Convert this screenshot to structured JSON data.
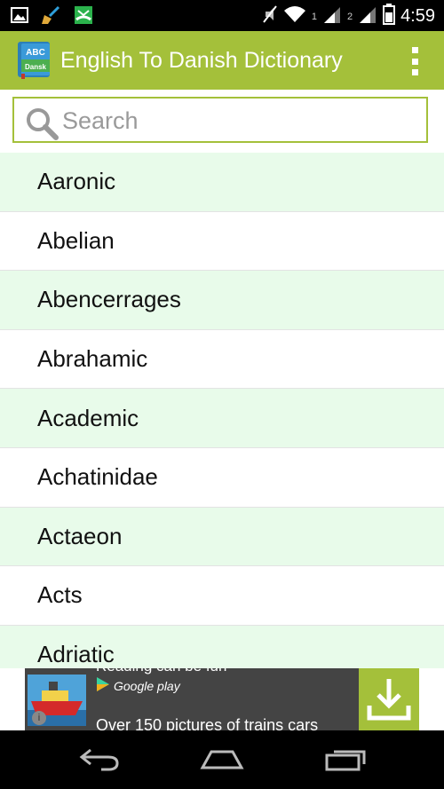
{
  "status_bar": {
    "time": "4:59",
    "sim1_label": "1",
    "sim2_label": "2"
  },
  "action_bar": {
    "icon_top_text": "ABC",
    "icon_bottom_text": "Dansk",
    "title": "English To Danish Dictionary"
  },
  "search": {
    "placeholder": "Search",
    "value": ""
  },
  "words": [
    "Aaronic",
    "Abelian",
    "Abencerrages",
    "Abrahamic",
    "Academic",
    "Achatinidae",
    "Actaeon",
    "Acts",
    "Adriatic"
  ],
  "ad": {
    "top_text": "Reading can be fun",
    "store_label": "Google play",
    "description": "Over 150 pictures of trains cars",
    "info_glyph": "i"
  },
  "colors": {
    "accent": "#a4c03a",
    "row_alt": "#e8fbea"
  }
}
